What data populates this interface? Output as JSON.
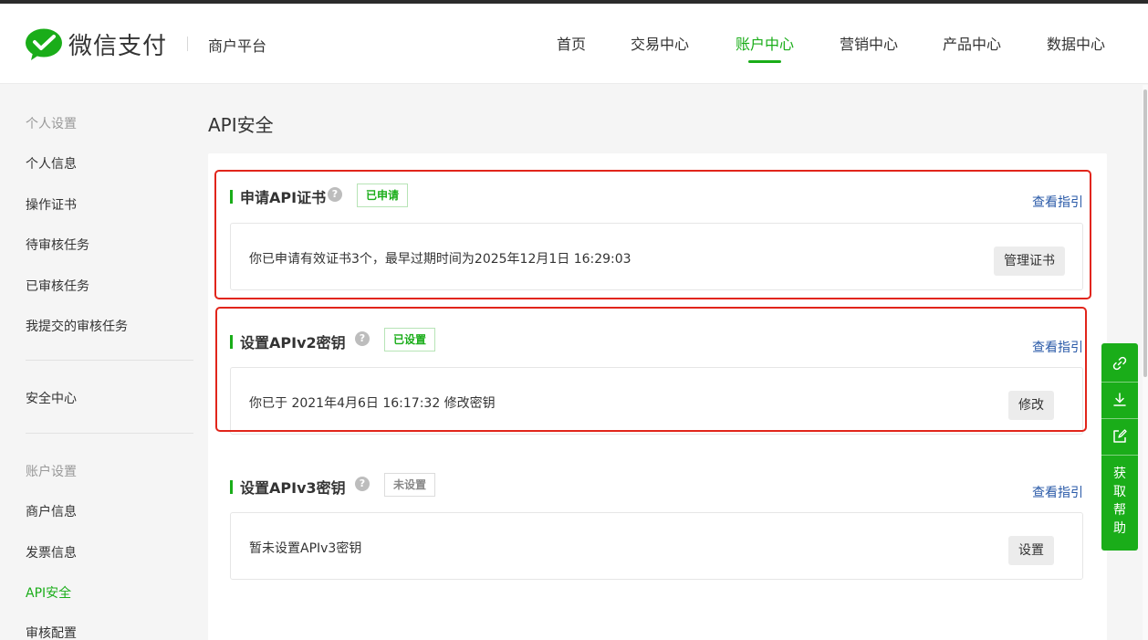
{
  "header": {
    "logo_text": "微信支付",
    "platform": "商户平台",
    "nav": [
      {
        "label": "首页"
      },
      {
        "label": "交易中心"
      },
      {
        "label": "账户中心",
        "active": true
      },
      {
        "label": "营销中心"
      },
      {
        "label": "产品中心"
      },
      {
        "label": "数据中心"
      }
    ]
  },
  "sidebar": {
    "group_personal": "个人设置",
    "personal_items": [
      "个人信息",
      "操作证书",
      "待审核任务",
      "已审核任务",
      "我提交的审核任务"
    ],
    "security_center": "安全中心",
    "group_account": "账户设置",
    "account_items": [
      "商户信息",
      "发票信息",
      "API安全",
      "审核配置"
    ],
    "active": "API安全"
  },
  "page": {
    "title": "API安全"
  },
  "sections": [
    {
      "title": "申请API证书",
      "help": "?",
      "badge": "已申请",
      "guide": "查看指引",
      "text": "你已申请有效证书3个，最早过期时间为2025年12月1日 16:29:03",
      "button": "管理证书"
    },
    {
      "title": "设置APIv2密钥",
      "help": "?",
      "badge": "已设置",
      "guide": "查看指引",
      "text": "你已于 2021年4月6日 16:17:32 修改密钥",
      "button": "修改"
    },
    {
      "title": "设置APIv3密钥",
      "help": "?",
      "badge": "未设置",
      "guide": "查看指引",
      "text": "暂未设置APIv3密钥",
      "button": "设置"
    }
  ],
  "float_bar": {
    "help_chars": [
      "获",
      "取",
      "帮",
      "助"
    ]
  },
  "colors": {
    "brand": "#1aad19",
    "link": "#2a5aa8",
    "highlight": "#e1251b"
  }
}
